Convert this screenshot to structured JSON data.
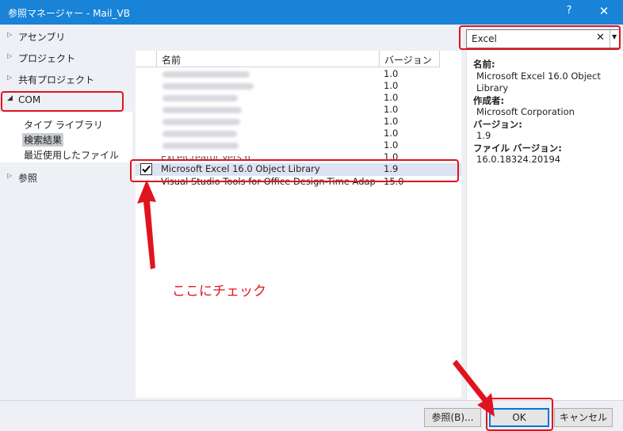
{
  "window": {
    "title": "参照マネージャー - Mail_VB",
    "help_glyph": "?",
    "close_glyph": "✕"
  },
  "sidebar": {
    "items": [
      {
        "label": "アセンブリ",
        "arrow": "▷"
      },
      {
        "label": "プロジェクト",
        "arrow": "▷"
      },
      {
        "label": "共有プロジェクト",
        "arrow": "▷"
      },
      {
        "label": "COM",
        "arrow": "◢"
      },
      {
        "label": "参照",
        "arrow": "▷"
      }
    ],
    "com_children": [
      "タイプ ライブラリ",
      "検索結果",
      "最近使用したファイル"
    ],
    "selected_child": "検索結果"
  },
  "search": {
    "value": "Excel",
    "clear_glyph": "✕",
    "dropdown_glyph": "▼"
  },
  "list": {
    "headers": {
      "name": "名前",
      "version": "バージョン"
    },
    "rows": [
      {
        "name": "",
        "version": "1.0",
        "blurred": true
      },
      {
        "name": "",
        "version": "1.0",
        "blurred": true
      },
      {
        "name": "",
        "version": "1.0",
        "blurred": true
      },
      {
        "name": "",
        "version": "1.0",
        "blurred": true
      },
      {
        "name": "",
        "version": "1.0",
        "blurred": true
      },
      {
        "name": "",
        "version": "1.0",
        "blurred": true
      },
      {
        "name": "",
        "version": "1.0",
        "blurred": true
      },
      {
        "name": "ExcelCreator Vers.6",
        "version": "1.0",
        "blurred": false
      },
      {
        "name": "Microsoft Excel 16.0 Object Library",
        "version": "1.9",
        "checked": true,
        "selected": true
      },
      {
        "name": "Visual Studio Tools for Office Design-Time Adapt...",
        "version": "15.0"
      }
    ]
  },
  "details": {
    "name_label": "名前:",
    "name_value": "Microsoft Excel 16.0 Object Library",
    "author_label": "作成者:",
    "author_value": "Microsoft Corporation",
    "version_label": "バージョン:",
    "version_value": "1.9",
    "file_version_label": "ファイル バージョン:",
    "file_version_value": "16.0.18324.20194"
  },
  "buttons": {
    "browse": "参照(B)...",
    "ok": "OK",
    "cancel": "キャンセル"
  },
  "annotation": {
    "text": "ここにチェック",
    "color": "#e0141e"
  },
  "colors": {
    "titlebar": "#1883d7",
    "highlight": "#e0141e",
    "selected_row": "#dde3f2"
  }
}
